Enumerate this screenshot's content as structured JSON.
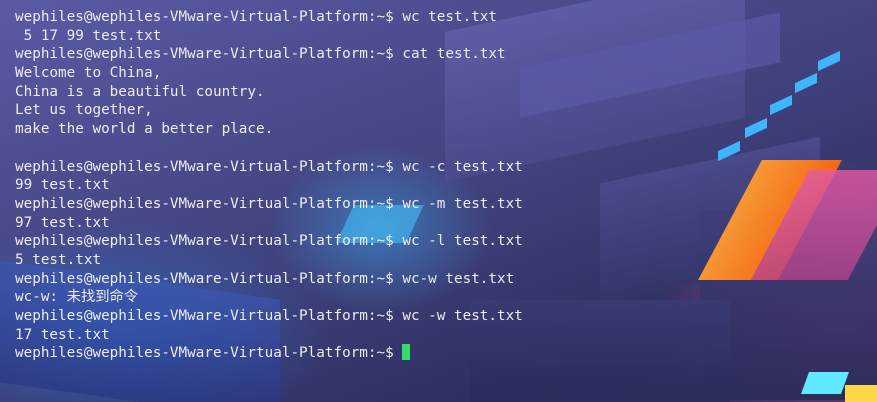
{
  "terminal": {
    "prompt": "wephiles@wephiles-VMware-Virtual-Platform:~$",
    "lines": [
      {
        "type": "command",
        "text": "wc test.txt"
      },
      {
        "type": "output",
        "text": " 5 17 99 test.txt"
      },
      {
        "type": "command",
        "text": "cat test.txt"
      },
      {
        "type": "output",
        "text": "Welcome to China,"
      },
      {
        "type": "output",
        "text": "China is a beautiful country."
      },
      {
        "type": "output",
        "text": "Let us together,"
      },
      {
        "type": "output",
        "text": "make the world a better place."
      },
      {
        "type": "output",
        "text": ""
      },
      {
        "type": "command",
        "text": "wc -c test.txt"
      },
      {
        "type": "output",
        "text": "99 test.txt"
      },
      {
        "type": "command",
        "text": "wc -m test.txt"
      },
      {
        "type": "output",
        "text": "97 test.txt"
      },
      {
        "type": "command",
        "text": "wc -l test.txt"
      },
      {
        "type": "output",
        "text": "5 test.txt"
      },
      {
        "type": "command",
        "text": "wc-w test.txt"
      },
      {
        "type": "output",
        "text": "wc-w: 未找到命令"
      },
      {
        "type": "command",
        "text": "wc -w test.txt"
      },
      {
        "type": "output",
        "text": "17 test.txt"
      },
      {
        "type": "prompt",
        "text": ""
      }
    ],
    "colors": {
      "text": "#ececec",
      "cursor": "#2ee06a"
    }
  }
}
